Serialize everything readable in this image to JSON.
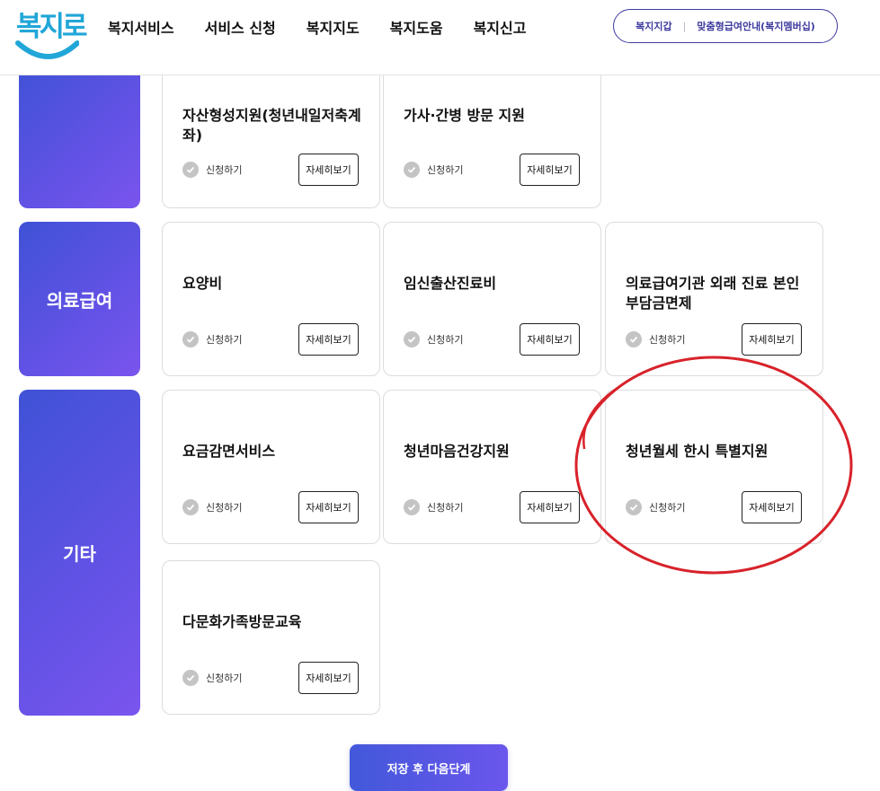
{
  "header": {
    "logo_text": "복지로",
    "nav": [
      "복지서비스",
      "서비스 신청",
      "복지지도",
      "복지도움",
      "복지신고"
    ],
    "pill": {
      "left": "복지지갑",
      "right": "맞춤형급여안내(복지멤버십)"
    }
  },
  "categories": {
    "medical": "의료급여",
    "etc": "기타"
  },
  "cards": {
    "top1": {
      "title": "자산형성지원(청년내일저축계좌)",
      "apply": "신청하기",
      "detail": "자세히보기"
    },
    "top2": {
      "title": "가사·간병 방문 지원",
      "apply": "신청하기",
      "detail": "자세히보기"
    },
    "med1": {
      "title": "요양비",
      "apply": "신청하기",
      "detail": "자세히보기"
    },
    "med2": {
      "title": "임신출산진료비",
      "apply": "신청하기",
      "detail": "자세히보기"
    },
    "med3": {
      "title": "의료급여기관 외래 진료 본인부담금면제",
      "apply": "신청하기",
      "detail": "자세히보기"
    },
    "etc1": {
      "title": "요금감면서비스",
      "apply": "신청하기",
      "detail": "자세히보기"
    },
    "etc2": {
      "title": "청년마음건강지원",
      "apply": "신청하기",
      "detail": "자세히보기"
    },
    "etc3": {
      "title": "청년월세 한시 특별지원",
      "apply": "신청하기",
      "detail": "자세히보기"
    },
    "etc4": {
      "title": "다문화가족방문교육",
      "apply": "신청하기",
      "detail": "자세히보기"
    }
  },
  "save_button": "저장 후 다음단계",
  "colors": {
    "brand_blue": "#21a6d8",
    "accent_purple": "#6052e4",
    "annotation_red": "#d8222a"
  }
}
